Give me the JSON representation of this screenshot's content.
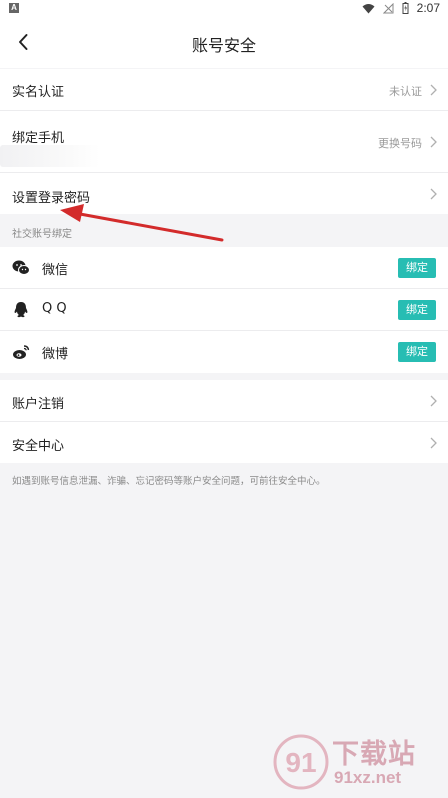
{
  "status_bar": {
    "badge": "A",
    "time": "2:07"
  },
  "header": {
    "title": "账号安全",
    "back_icon": "chevron-left-icon"
  },
  "account_rows": [
    {
      "label": "实名认证",
      "hint": "未认证"
    },
    {
      "label": "绑定手机",
      "hint": "更换号码"
    },
    {
      "label": "设置登录密码",
      "hint": ""
    }
  ],
  "social_section": {
    "title": "社交账号绑定",
    "items": [
      {
        "label": "微信",
        "icon": "wechat-icon",
        "button": "绑定"
      },
      {
        "label": "Q Q",
        "icon": "qq-icon",
        "button": "绑定"
      },
      {
        "label": "微博",
        "icon": "weibo-icon",
        "button": "绑定"
      }
    ]
  },
  "other_rows": [
    {
      "label": "账户注销"
    },
    {
      "label": "安全中心"
    }
  ],
  "footnote": "如遇到账号信息泄漏、诈骗、忘记密码等账户安全问题，可前往安全中心。",
  "watermark": {
    "main": "下载站",
    "sub": "91xz.net",
    "logo_text": "91"
  },
  "colors": {
    "bind_button": "#27bdb3",
    "arrow": "#d32b2b"
  }
}
